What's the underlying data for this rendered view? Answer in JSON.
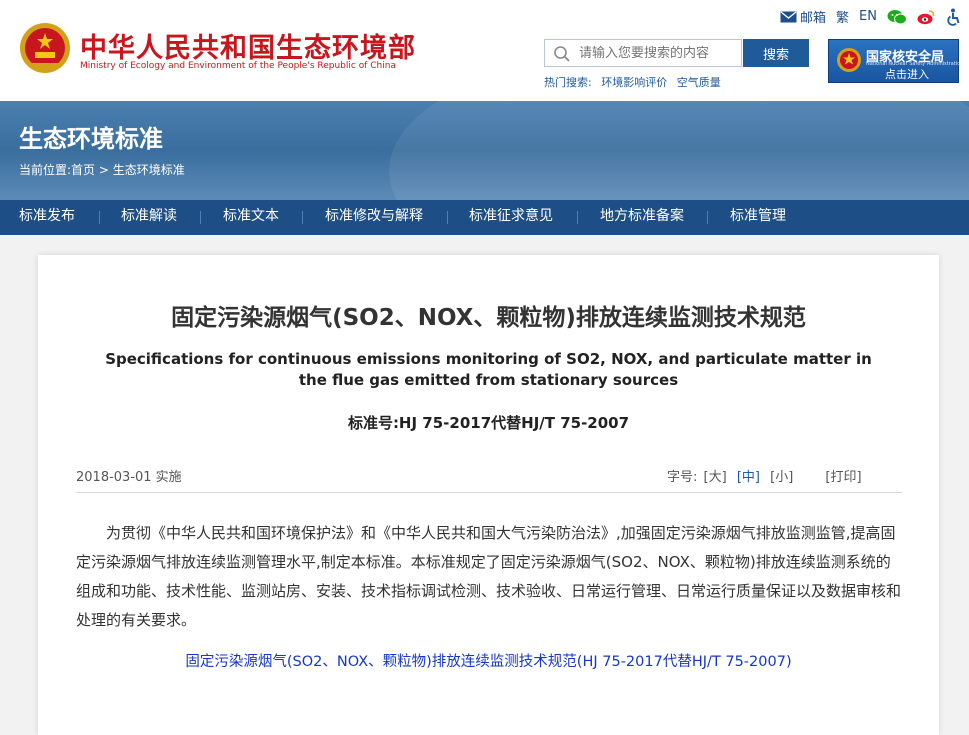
{
  "header": {
    "ministry_cn": "中华人民共和国生态环境部",
    "ministry_en": "Ministry of Ecology and Environment of the People's Republic of China",
    "top_links": {
      "mail": "邮箱",
      "traditional": "繁",
      "english": "EN"
    },
    "search": {
      "placeholder": "请输入您要搜索的内容",
      "button": "搜索"
    },
    "hot_search": {
      "label": "热门搜索:",
      "items": [
        "环境影响评价",
        "空气质量"
      ]
    },
    "nnsa": {
      "title": "国家核安全局",
      "subtitle": "National Nuclear Safety Administration",
      "action": "点击进入"
    }
  },
  "banner": {
    "title": "生态环境标准",
    "breadcrumb_prefix": "当前位置:",
    "breadcrumb_home": "首页",
    "breadcrumb_sep": ">",
    "breadcrumb_current": "生态环境标准"
  },
  "nav": {
    "items": [
      "标准发布",
      "标准解读",
      "标准文本",
      "标准修改与解释",
      "标准征求意见",
      "地方标准备案",
      "标准管理"
    ]
  },
  "article": {
    "title_cn": "固定污染源烟气(SO2、NOX、颗粒物)排放连续监测技术规范",
    "title_en": "Specifications for continuous emissions monitoring of SO2, NOX, and particulate matter in the flue gas emitted from stationary sources",
    "standard_no": "标准号:HJ 75-2017代替HJ/T 75-2007",
    "effective_date": "2018-03-01 实施",
    "font_size_label": "字号:",
    "font_large": "[大]",
    "font_medium": "[中]",
    "font_small": "[小]",
    "print": "[打印]",
    "body": "为贯彻《中华人民共和国环境保护法》和《中华人民共和国大气污染防治法》,加强固定污染源烟气排放监测监管,提高固定污染源烟气排放连续监测管理水平,制定本标准。本标准规定了固定污染源烟气(SO2、NOX、颗粒物)排放连续监测系统的组成和功能、技术性能、监测站房、安装、技术指标调试检测、技术验收、日常运行管理、日常运行质量保证以及数据审核和处理的有关要求。",
    "document_link": "固定污染源烟气(SO2、NOX、颗粒物)排放连续监测技术规范(HJ 75-2017代替HJ/T 75-2007)"
  }
}
